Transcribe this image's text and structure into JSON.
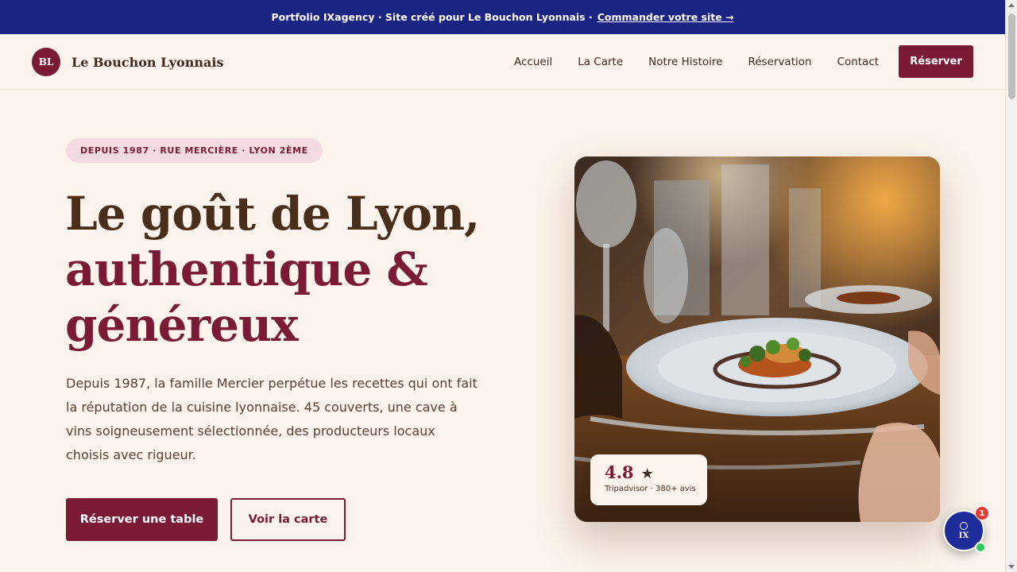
{
  "banner": {
    "text": "Portfolio IXagency · Site créé pour Le Bouchon Lyonnais ·",
    "link": "Commander votre site →"
  },
  "nav": {
    "logo_initials": "BL",
    "logo_name": "Le Bouchon Lyonnais",
    "links": [
      "Accueil",
      "La Carte",
      "Notre Histoire",
      "Réservation",
      "Contact"
    ],
    "cta": "Réserver"
  },
  "hero": {
    "pill": "DEPUIS 1987 · RUE MERCIÈRE · LYON 2ÈME",
    "headline_line1": "Le goût de Lyon,",
    "headline_line2": "authentique &",
    "headline_line3": "généreux",
    "description": "Depuis 1987, la famille Mercier perpétue les recettes qui ont fait la réputation de la cuisine lyonnaise. 45 couverts, une cave à vins soigneusement sélectionnée, des producteurs locaux choisis avec rigueur.",
    "cta_primary": "Réserver une table",
    "cta_secondary": "Voir la carte"
  },
  "rating": {
    "score": "4.8",
    "star": "★",
    "source": "Tripadvisor · 380+ avis"
  },
  "chat": {
    "label": "IX",
    "badge": "1"
  },
  "colors": {
    "brand": "#7b1a35",
    "banner": "#1b2383",
    "background": "#fcf4ec",
    "heading_dark": "#4a2e1c"
  },
  "icons": [
    "restaurant-photo",
    "chat-icon",
    "star-icon",
    "scrollbar"
  ]
}
